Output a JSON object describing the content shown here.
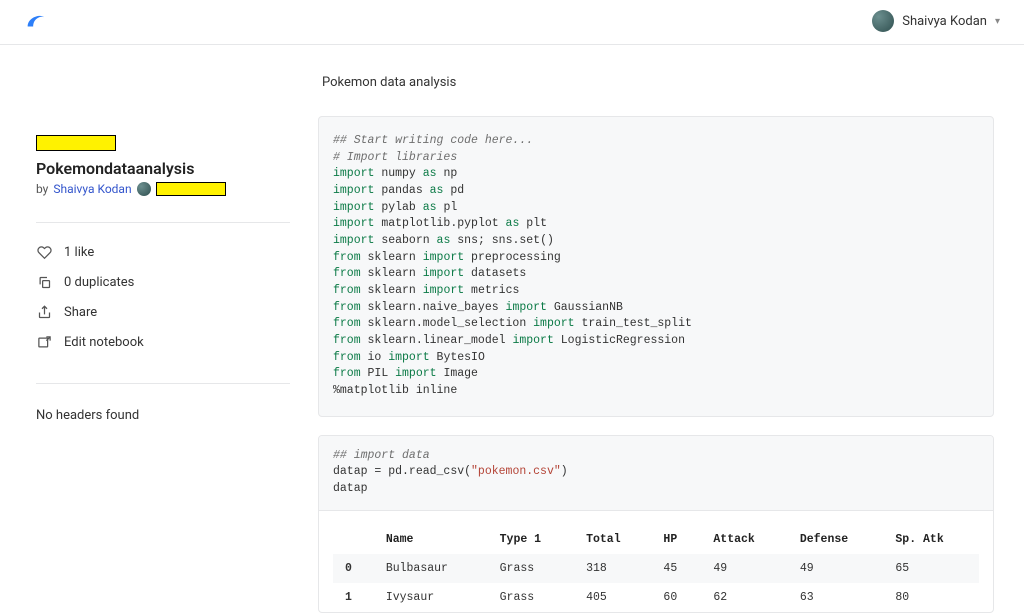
{
  "header": {
    "user_name": "Shaivya Kodan"
  },
  "sidebar": {
    "title": "Pokemondataanalysis",
    "by_prefix": "by",
    "author": "Shaivya Kodan",
    "likes_label": "1 like",
    "duplicates_label": "0 duplicates",
    "share_label": "Share",
    "edit_label": "Edit notebook",
    "no_headers": "No headers found"
  },
  "content": {
    "title": "Pokemon data analysis",
    "code1": {
      "l1": "## Start writing code here...",
      "l2": "# Import libraries",
      "l3a": "import",
      "l3b": " numpy ",
      "l3c": "as",
      "l3d": " np",
      "l4a": "import",
      "l4b": " pandas ",
      "l4c": "as",
      "l4d": " pd",
      "l5a": "import",
      "l5b": " pylab ",
      "l5c": "as",
      "l5d": " pl",
      "l6a": "import",
      "l6b": " matplotlib.pyplot ",
      "l6c": "as",
      "l6d": " plt",
      "l7a": "import",
      "l7b": " seaborn ",
      "l7c": "as",
      "l7d": " sns; sns.set()",
      "l8a": "from",
      "l8b": " sklearn ",
      "l8c": "import",
      "l8d": " preprocessing",
      "l9a": "from",
      "l9b": " sklearn ",
      "l9c": "import",
      "l9d": " datasets",
      "l10a": "from",
      "l10b": " sklearn ",
      "l10c": "import",
      "l10d": " metrics",
      "l11a": "from",
      "l11b": " sklearn.naive_bayes ",
      "l11c": "import",
      "l11d": " GaussianNB",
      "l12a": "from",
      "l12b": " sklearn.model_selection ",
      "l12c": "import",
      "l12d": " train_test_split",
      "l13a": "from",
      "l13b": " sklearn.linear_model ",
      "l13c": "import",
      "l13d": " LogisticRegression",
      "l14a": "from",
      "l14b": " io ",
      "l14c": "import",
      "l14d": " BytesIO",
      "l15a": "from",
      "l15b": " PIL ",
      "l15c": "import",
      "l15d": " Image",
      "l16": "%matplotlib inline"
    },
    "code2": {
      "l1": "## import data",
      "l2a": "datap = pd.read_csv(",
      "l2b": "\"pokemon.csv\"",
      "l2c": ")",
      "l3": "datap"
    },
    "table": {
      "columns": [
        "",
        "Name",
        "Type 1",
        "Total",
        "HP",
        "Attack",
        "Defense",
        "Sp. Atk"
      ],
      "rows": [
        {
          "idx": "0",
          "name": "Bulbasaur",
          "type1": "Grass",
          "total": "318",
          "hp": "45",
          "attack": "49",
          "defense": "49",
          "spatk": "65"
        },
        {
          "idx": "1",
          "name": "Ivysaur",
          "type1": "Grass",
          "total": "405",
          "hp": "60",
          "attack": "62",
          "defense": "63",
          "spatk": "80"
        }
      ]
    }
  }
}
